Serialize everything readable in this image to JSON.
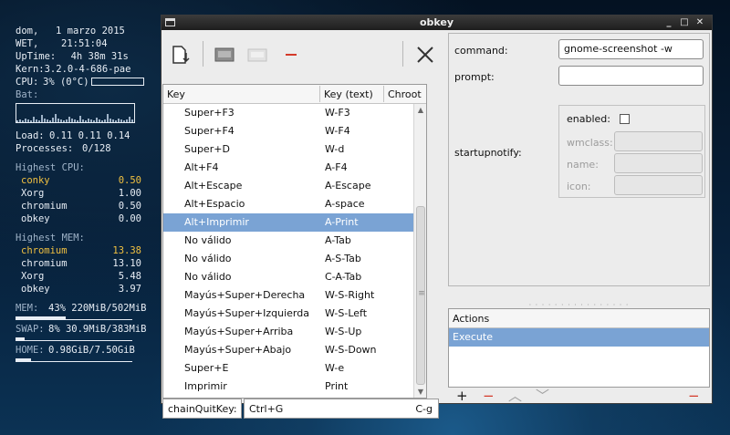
{
  "conky": {
    "date_label": "dom,",
    "date_value": "1 marzo 2015",
    "tz_label": "WET,",
    "time_value": "21:51:04",
    "uptime_label": "UpTime:",
    "uptime_value": "4h 38m 31s",
    "kernel_label": "Kern:",
    "kernel_value": "3.2.0-4-686-pae",
    "cpu_label": "CPU:",
    "cpu_value": "3% (0°C)",
    "cpu_fraction": 0.03,
    "bat_label": "Bat:",
    "load_label": "Load:",
    "load_value": "0.11 0.11 0.14",
    "proc_label": "Processes:",
    "proc_value": "0/128",
    "highest_cpu_title": "Highest CPU:",
    "highest_cpu": [
      {
        "name": "conky",
        "value": "0.50"
      },
      {
        "name": "Xorg",
        "value": "1.00"
      },
      {
        "name": "chromium",
        "value": "0.50"
      },
      {
        "name": "obkey",
        "value": "0.00"
      }
    ],
    "highest_mem_title": "Highest MEM:",
    "highest_mem": [
      {
        "name": "chromium",
        "value": "13.38"
      },
      {
        "name": "chromium",
        "value": "13.10"
      },
      {
        "name": "Xorg",
        "value": "5.48"
      },
      {
        "name": "obkey",
        "value": "3.97"
      }
    ],
    "mem_label": "MEM:",
    "mem_value": "43% 220MiB/502MiB",
    "mem_fraction": 0.43,
    "swap_label": "SWAP:",
    "swap_value": "8% 30.9MiB/383MiB",
    "swap_fraction": 0.08,
    "home_label": "HOME:",
    "home_value": "0.98GiB/7.50GiB",
    "home_fraction": 0.13,
    "colors": {
      "text": "#e8eef5",
      "highlight": "#f0c040"
    }
  },
  "window": {
    "title": "obkey",
    "buttons": {
      "iconify": "_",
      "maximize": "□",
      "close": "✕"
    }
  },
  "toolbar": {
    "icons": [
      "document-import-icon",
      "save-icon",
      "save-as-icon",
      "remove-icon",
      "quit-icon"
    ]
  },
  "keylist": {
    "headers": {
      "key": "Key",
      "key_text": "Key (text)",
      "chroot": "Chroot"
    },
    "rows": [
      {
        "key": "Super+F3",
        "text": "W-F3",
        "selected": false
      },
      {
        "key": "Super+F4",
        "text": "W-F4",
        "selected": false
      },
      {
        "key": "Super+D",
        "text": "W-d",
        "selected": false
      },
      {
        "key": "Alt+F4",
        "text": "A-F4",
        "selected": false
      },
      {
        "key": "Alt+Escape",
        "text": "A-Escape",
        "selected": false
      },
      {
        "key": "Alt+Espacio",
        "text": "A-space",
        "selected": false
      },
      {
        "key": "Alt+Imprimir",
        "text": "A-Print",
        "selected": true
      },
      {
        "key": "No válido",
        "text": "A-Tab",
        "selected": false
      },
      {
        "key": "No válido",
        "text": "A-S-Tab",
        "selected": false
      },
      {
        "key": "No válido",
        "text": "C-A-Tab",
        "selected": false
      },
      {
        "key": "Mayús+Super+Derecha",
        "text": "W-S-Right",
        "selected": false
      },
      {
        "key": "Mayús+Super+Izquierda",
        "text": "W-S-Left",
        "selected": false
      },
      {
        "key": "Mayús+Super+Arriba",
        "text": "W-S-Up",
        "selected": false
      },
      {
        "key": "Mayús+Super+Abajo",
        "text": "W-S-Down",
        "selected": false
      },
      {
        "key": "Super+E",
        "text": "W-e",
        "selected": false
      },
      {
        "key": "Imprimir",
        "text": "Print",
        "selected": false
      }
    ]
  },
  "chain": {
    "label": "chainQuitKey:",
    "value": "Ctrl+G",
    "value_text": "C-g"
  },
  "props": {
    "command_label": "command:",
    "command_value": "gnome-screenshot -w",
    "prompt_label": "prompt:",
    "prompt_value": "",
    "startupnotify_label": "startupnotify:",
    "enabled_label": "enabled:",
    "enabled_checked": false,
    "wmclass_label": "wmclass:",
    "name_label": "name:",
    "icon_label": "icon:"
  },
  "actions": {
    "header": "Actions",
    "items": [
      {
        "label": "Execute",
        "selected": true
      }
    ],
    "buttons": {
      "add": "+",
      "remove": "−",
      "up": "︿",
      "down": "﹀",
      "clear": "−"
    }
  },
  "colors": {
    "selection": "#7aa3d4",
    "remove_red": "#d43a2a",
    "window_bg": "#ececec"
  }
}
